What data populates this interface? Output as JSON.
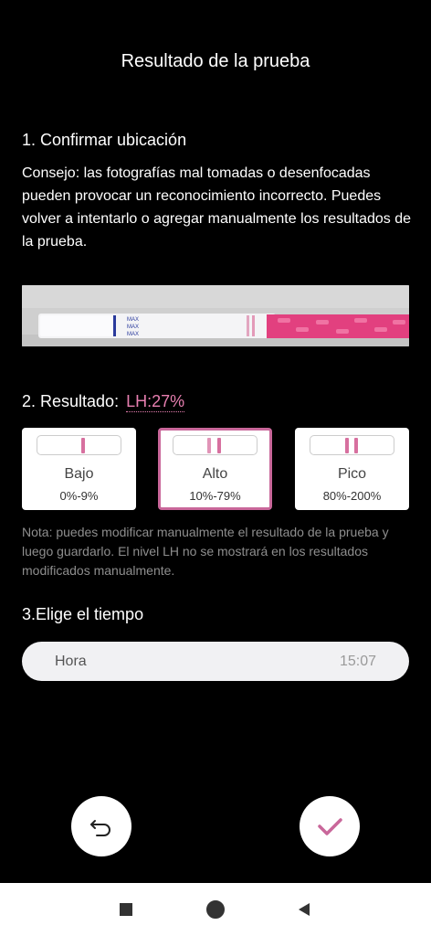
{
  "header": {
    "title": "Resultado de la prueba"
  },
  "location": {
    "heading": "1. Confirmar ubicación",
    "tip": "Consejo: las fotografías mal tomadas o desenfocadas pueden provocar un reconocimiento incorrecto. Puedes volver a intentarlo o agregar manualmente los resultados de la prueba."
  },
  "photo": {
    "strip_text": "MAX"
  },
  "result": {
    "heading": "2. Resultado:",
    "lh_value": "LH:27%",
    "options": [
      {
        "label": "Bajo",
        "range": "0%-9%"
      },
      {
        "label": "Alto",
        "range": "10%-79%"
      },
      {
        "label": "Pico",
        "range": "80%-200%"
      }
    ],
    "selected_label": "Alto",
    "note": "Nota: puedes modificar manualmente el resultado de la prueba y luego guardarlo. El nivel LH no se mostrará en los resultados modificados manualmente."
  },
  "time": {
    "heading": "3.Elige el tiempo",
    "label": "Hora",
    "value": "15:07"
  },
  "icons": {
    "undo": "undo-icon",
    "confirm": "check-icon",
    "nav_recents": "square-icon",
    "nav_home": "circle-icon",
    "nav_back": "triangle-back-icon"
  },
  "colors": {
    "accent": "#d7709f",
    "background": "#000000"
  }
}
